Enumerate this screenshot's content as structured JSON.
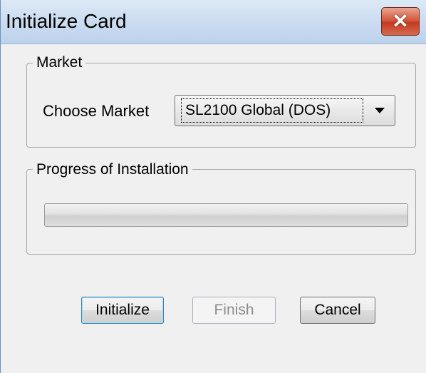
{
  "window": {
    "title": "Initialize Card",
    "close_icon": "close-icon"
  },
  "market": {
    "legend": "Market",
    "choose_label": "Choose Market",
    "selected_value": "SL2100 Global (DOS)"
  },
  "progress": {
    "legend": "Progress of Installation",
    "value_percent": 0
  },
  "buttons": {
    "initialize": "Initialize",
    "finish": "Finish",
    "cancel": "Cancel"
  },
  "colors": {
    "close_button": "#c23b22",
    "titlebar": "#c8daf0",
    "window_bg": "#f0f0f0"
  }
}
